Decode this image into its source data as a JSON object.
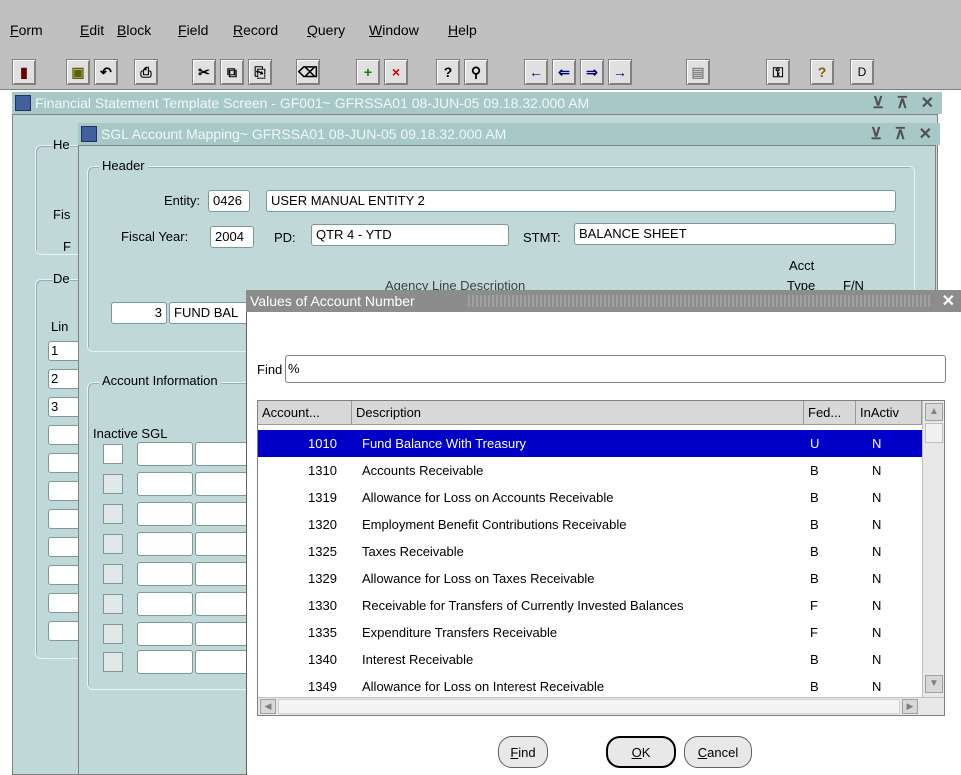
{
  "menubar": {
    "items": [
      {
        "first": "F",
        "rest": "orm"
      },
      {
        "first": "E",
        "rest": "dit"
      },
      {
        "first": "B",
        "rest": "lock"
      },
      {
        "first": "F",
        "rest": "ield"
      },
      {
        "first": "R",
        "rest": "ecord"
      },
      {
        "first": "Q",
        "rest": "uery"
      },
      {
        "first": "W",
        "rest": "indow"
      },
      {
        "first": "H",
        "rest": "elp"
      }
    ]
  },
  "toolbar": {
    "buttons": [
      {
        "icon": "exit-icon",
        "glyph": "▮"
      },
      {
        "icon": "save-icon",
        "glyph": "▣"
      },
      {
        "icon": "undo-icon",
        "glyph": "↶"
      },
      {
        "icon": "print-icon",
        "glyph": "⎙"
      },
      {
        "icon": "cut-icon",
        "glyph": "✂"
      },
      {
        "icon": "copy-icon",
        "glyph": "⧉"
      },
      {
        "icon": "paste-icon",
        "glyph": "⎘"
      },
      {
        "icon": "clear-icon",
        "glyph": "⌫"
      },
      {
        "icon": "insert-record-icon",
        "glyph": "+"
      },
      {
        "icon": "delete-record-icon",
        "glyph": "×"
      },
      {
        "icon": "enter-query-icon",
        "glyph": "?"
      },
      {
        "icon": "execute-query-icon",
        "glyph": "⚲"
      },
      {
        "icon": "previous-block-icon",
        "glyph": "←"
      },
      {
        "icon": "previous-record-icon",
        "glyph": "⇐"
      },
      {
        "icon": "next-record-icon",
        "glyph": "⇒"
      },
      {
        "icon": "next-block-icon",
        "glyph": "→"
      },
      {
        "icon": "list-icon",
        "glyph": "▤"
      },
      {
        "icon": "key-icon",
        "glyph": "⚿"
      },
      {
        "icon": "help-icon",
        "glyph": "?"
      }
    ],
    "d_button": "D"
  },
  "back_window": {
    "title": "Financial Statement Template Screen - GF001~ GFRSSA01  08-JUN-05 09.18.32.000 AM",
    "side_labels": [
      "He",
      "Fis",
      "F",
      "De",
      "Lin"
    ],
    "line_numbers": [
      "1",
      "2",
      "3"
    ]
  },
  "front_window": {
    "title": "SGL Account Mapping~ GFRSSA01  08-JUN-05 09.18.32.000 AM",
    "header_group": "Header",
    "entity_label": "Entity:",
    "entity_code": "0426",
    "entity_name": "USER MANUAL ENTITY 2",
    "fiscal_year_label": "Fiscal Year:",
    "fiscal_year": "2004",
    "pd_label": "PD:",
    "pd_value": "QTR 4 - YTD",
    "stmt_label": "STMT:",
    "stmt_value": "BALANCE SHEET",
    "acct_label": "Acct",
    "line_desc_partial": "Agency Line Description",
    "type_partial": "Type",
    "fn_partial": "F/N",
    "line_number": "3",
    "line_desc": "FUND BAL",
    "account_info_group": "Account Information",
    "inactive_sgl_label": "Inactive SGL"
  },
  "lov": {
    "title": "Values of Account Number",
    "find_label": "Find",
    "find_value": "%",
    "columns": [
      "Account...",
      "Description",
      "Fed...",
      "InActiv"
    ],
    "rows": [
      {
        "account": "1010",
        "description": "Fund Balance With Treasury",
        "fed": "U",
        "inactive": "N"
      },
      {
        "account": "1310",
        "description": "Accounts Receivable",
        "fed": "B",
        "inactive": "N"
      },
      {
        "account": "1319",
        "description": "Allowance for Loss on Accounts Receivable",
        "fed": "B",
        "inactive": "N"
      },
      {
        "account": "1320",
        "description": "Employment Benefit Contributions Receivable",
        "fed": "B",
        "inactive": "N"
      },
      {
        "account": "1325",
        "description": "Taxes Receivable",
        "fed": "B",
        "inactive": "N"
      },
      {
        "account": "1329",
        "description": "Allowance for Loss on Taxes Receivable",
        "fed": "B",
        "inactive": "N"
      },
      {
        "account": "1330",
        "description": "Receivable for Transfers of Currently Invested Balances",
        "fed": "F",
        "inactive": "N"
      },
      {
        "account": "1335",
        "description": "Expenditure Transfers Receivable",
        "fed": "F",
        "inactive": "N"
      },
      {
        "account": "1340",
        "description": "Interest Receivable",
        "fed": "B",
        "inactive": "N"
      },
      {
        "account": "1349",
        "description": "Allowance for Loss on Interest Receivable",
        "fed": "B",
        "inactive": "N"
      }
    ],
    "buttons": {
      "find_first": "F",
      "find_rest": "ind",
      "ok_first": "O",
      "ok_rest": "K",
      "cancel_first": "C",
      "cancel_rest": "ancel"
    }
  },
  "colors": {
    "titlebar": "#a8c8c8",
    "form_background": "#c0d8d8",
    "selection": "#0000c8",
    "lov_titlebar": "#8c8c8c"
  }
}
